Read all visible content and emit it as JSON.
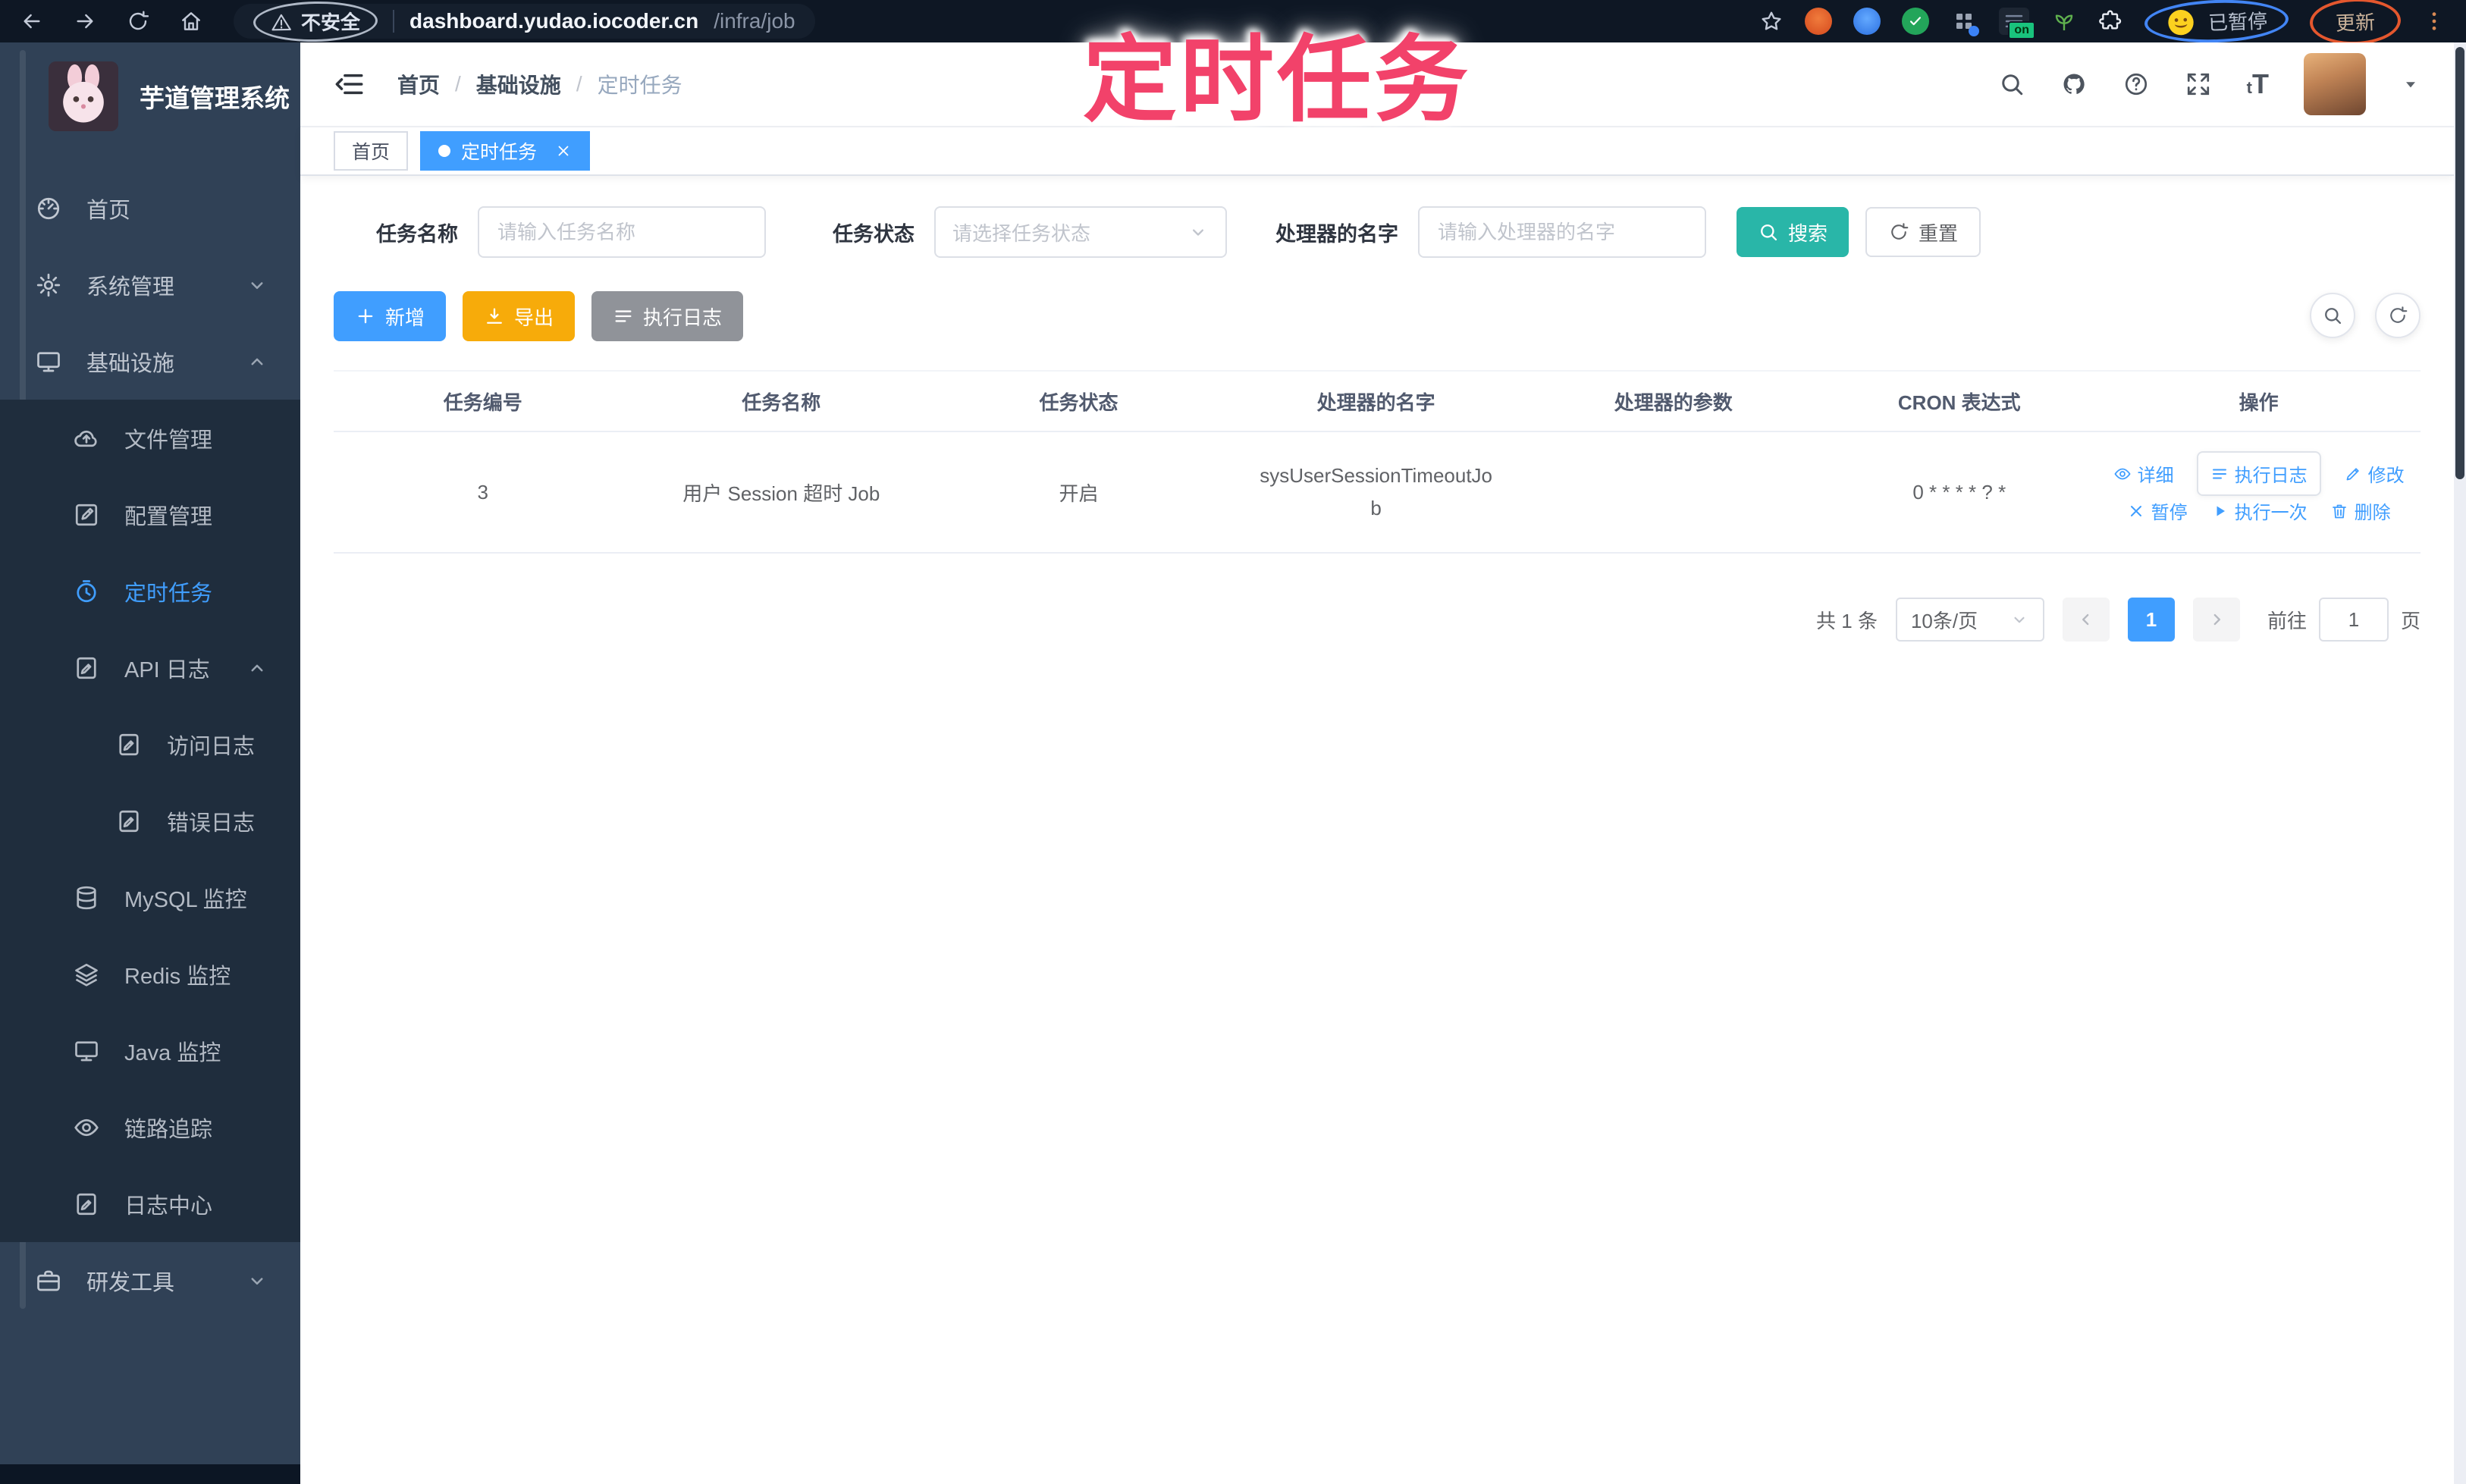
{
  "colors": {
    "accent": "#409EFF",
    "sidebar_bg": "#304156",
    "submenu_bg": "#1f2d3d",
    "search_button": "#29b6a8",
    "export_button": "#f7ab0a",
    "info_button": "#909399",
    "tag_active": "#409EFF",
    "annotation": "#f2426a"
  },
  "browser": {
    "security_label": "不安全",
    "url_host": "dashboard.yudao.iocoder.cn",
    "url_path": "/infra/job",
    "ext_on_badge": "on",
    "paused_label": "已暂停",
    "update_label": "更新"
  },
  "annotation": {
    "text": "定时任务"
  },
  "sidebar": {
    "title": "芋道管理系统",
    "items": [
      {
        "label": "首页"
      },
      {
        "label": "系统管理"
      },
      {
        "label": "基础设施"
      },
      {
        "label": "文件管理"
      },
      {
        "label": "配置管理"
      },
      {
        "label": "定时任务"
      },
      {
        "label": "API 日志"
      },
      {
        "label": "访问日志"
      },
      {
        "label": "错误日志"
      },
      {
        "label": "MySQL 监控"
      },
      {
        "label": "Redis 监控"
      },
      {
        "label": "Java 监控"
      },
      {
        "label": "链路追踪"
      },
      {
        "label": "日志中心"
      },
      {
        "label": "研发工具"
      }
    ]
  },
  "breadcrumb": {
    "home": "首页",
    "section": "基础设施",
    "current": "定时任务",
    "separator": "/"
  },
  "tags": {
    "home": "首页",
    "current": "定时任务"
  },
  "filters": {
    "name_label": "任务名称",
    "name_placeholder": "请输入任务名称",
    "status_label": "任务状态",
    "status_placeholder": "请选择任务状态",
    "handler_label": "处理器的名字",
    "handler_placeholder": "请输入处理器的名字",
    "search_label": "搜索",
    "reset_label": "重置"
  },
  "toolbar": {
    "add_label": "新增",
    "export_label": "导出",
    "exec_log_label": "执行日志"
  },
  "table": {
    "headers": [
      "任务编号",
      "任务名称",
      "任务状态",
      "处理器的名字",
      "处理器的参数",
      "CRON 表达式",
      "操作"
    ],
    "row": {
      "id": "3",
      "name": "用户 Session 超时 Job",
      "status": "开启",
      "handler": "sysUserSessionTimeoutJob",
      "param": "",
      "cron": "0 * * * * ? *"
    },
    "ops": {
      "detail": "详细",
      "exec_log": "执行日志",
      "edit": "修改",
      "pause": "暂停",
      "run_once": "执行一次",
      "delete": "删除"
    }
  },
  "pagination": {
    "total": "共 1 条",
    "page_size": "10条/页",
    "page": "1",
    "goto": "前往",
    "unit": "页",
    "goto_value": "1"
  }
}
